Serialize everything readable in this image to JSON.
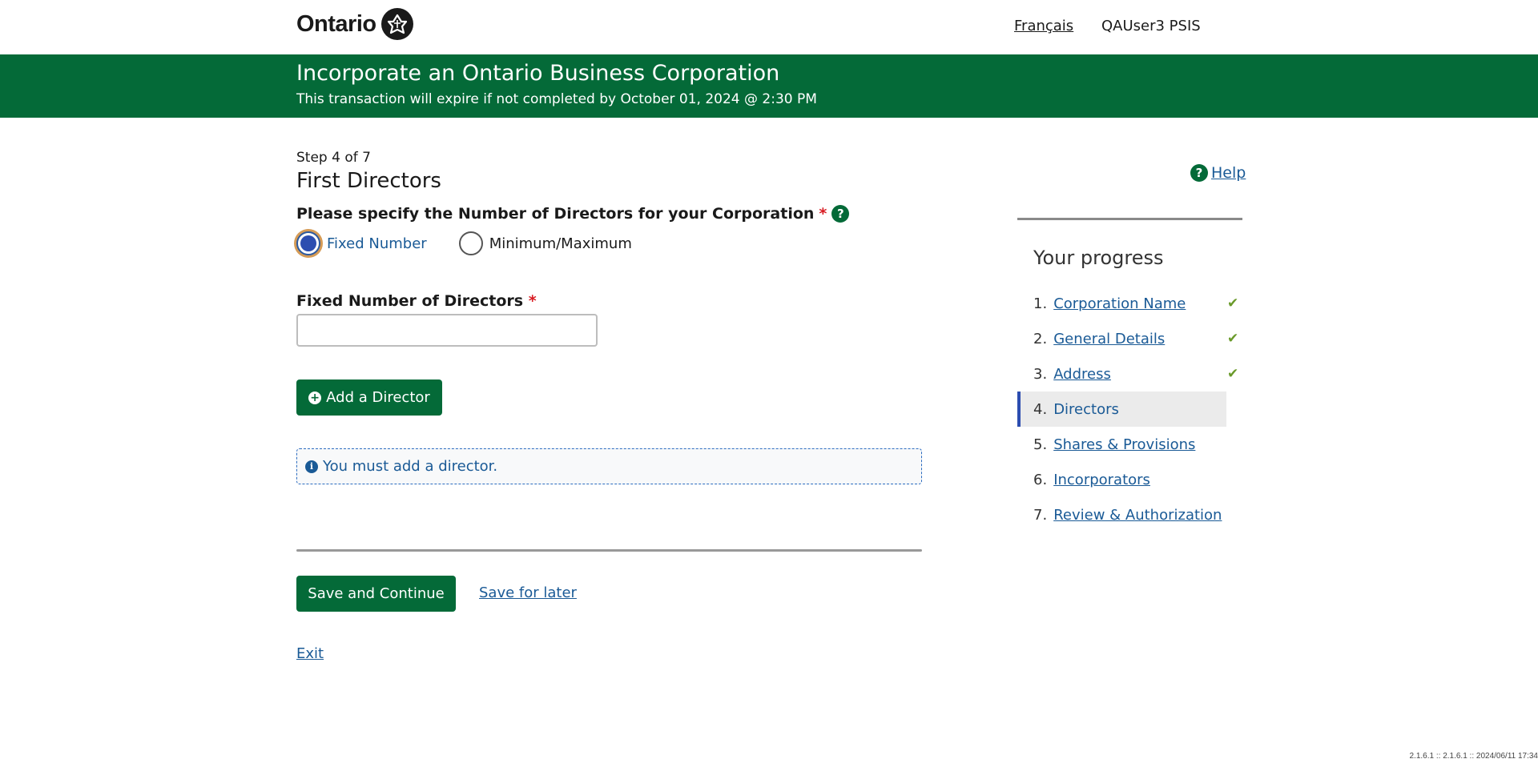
{
  "header": {
    "logo_text": "Ontario",
    "language_link": "Français",
    "user_name": "QAUser3 PSIS"
  },
  "banner": {
    "title": "Incorporate an Ontario Business Corporation",
    "subtitle": "This transaction will expire if not completed by October 01, 2024 @ 2:30 PM"
  },
  "main": {
    "step": "Step 4 of 7",
    "title": "First Directors",
    "question": "Please specify the Number of Directors for your Corporation",
    "required_mark": "*",
    "radio_options": [
      {
        "label": "Fixed Number",
        "checked": true
      },
      {
        "label": "Minimum/Maximum",
        "checked": false
      }
    ],
    "fixed_number_label": "Fixed Number of Directors",
    "fixed_number_value": "",
    "add_director_label": "Add a Director",
    "info_message": "You must add a director.",
    "save_continue_label": "Save and Continue",
    "save_later_label": "Save for later",
    "exit_label": "Exit"
  },
  "sidebar": {
    "help_label": "Help",
    "progress_title": "Your progress",
    "steps": [
      {
        "num": "1.",
        "label": "Corporation Name",
        "complete": true
      },
      {
        "num": "2.",
        "label": "General Details",
        "complete": true
      },
      {
        "num": "3.",
        "label": "Address",
        "complete": true
      },
      {
        "num": "4.",
        "label": "Directors",
        "current": true
      },
      {
        "num": "5.",
        "label": "Shares & Provisions"
      },
      {
        "num": "6.",
        "label": "Incorporators"
      },
      {
        "num": "7.",
        "label": "Review & Authorization"
      }
    ]
  },
  "footer": {
    "version": "2.1.6.1 :: 2.1.6.1 :: 2024/06/11 17:34"
  },
  "colors": {
    "brand_green": "#046a38",
    "link_blue": "#1a5a96",
    "required_red": "#d81a21",
    "check_green": "#6a9a2a"
  }
}
